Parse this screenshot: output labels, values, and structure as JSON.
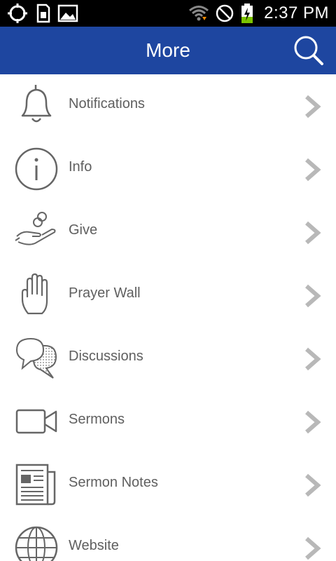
{
  "status_bar": {
    "time": "2:37 PM",
    "left_icons": [
      "gps-icon",
      "sd-card-icon",
      "image-icon"
    ],
    "right_icons": [
      "wifi-icon",
      "no-sync-icon",
      "battery-charging-icon"
    ]
  },
  "app_bar": {
    "title": "More",
    "search_icon": "search-icon",
    "color": "#1e46a0"
  },
  "menu": {
    "items": [
      {
        "label": "Notifications",
        "icon": "bell-icon"
      },
      {
        "label": "Info",
        "icon": "info-icon"
      },
      {
        "label": "Give",
        "icon": "give-hand-coins-icon"
      },
      {
        "label": "Prayer Wall",
        "icon": "hand-icon"
      },
      {
        "label": "Discussions",
        "icon": "speech-bubbles-icon"
      },
      {
        "label": "Sermons",
        "icon": "video-camera-icon"
      },
      {
        "label": "Sermon Notes",
        "icon": "newspaper-icon"
      },
      {
        "label": "Website",
        "icon": "globe-icon"
      }
    ],
    "chevron_icon": "chevron-right-icon"
  }
}
